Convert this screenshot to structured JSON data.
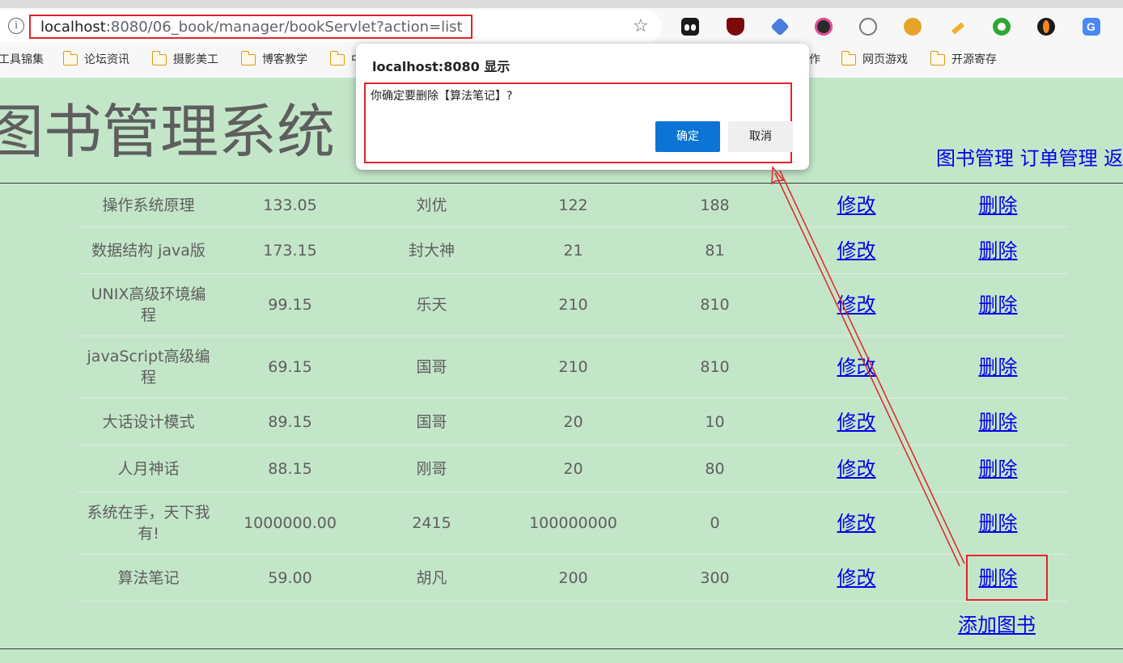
{
  "browser": {
    "url_host": "localhost",
    "url_rest": ":8080/06_book/manager/bookServlet?action=list",
    "bookmarks": [
      "工具锦集",
      "论坛资讯",
      "摄影美工",
      "博客教学",
      "中",
      "作",
      "网页游戏",
      "开源寄存"
    ]
  },
  "page": {
    "title": "图书管理系统",
    "nav": [
      "图书管理",
      "订单管理",
      "返"
    ],
    "rows": [
      {
        "name": "操作系统原理",
        "price": "133.05",
        "author": "刘优",
        "sales": "122",
        "stock": "188",
        "edit": "修改",
        "delete": "删除"
      },
      {
        "name": "数据结构 java版",
        "price": "173.15",
        "author": "封大神",
        "sales": "21",
        "stock": "81",
        "edit": "修改",
        "delete": "删除"
      },
      {
        "name": "UNIX高级环境编程",
        "price": "99.15",
        "author": "乐天",
        "sales": "210",
        "stock": "810",
        "edit": "修改",
        "delete": "删除"
      },
      {
        "name": "javaScript高级编程",
        "price": "69.15",
        "author": "国哥",
        "sales": "210",
        "stock": "810",
        "edit": "修改",
        "delete": "删除"
      },
      {
        "name": "大话设计模式",
        "price": "89.15",
        "author": "国哥",
        "sales": "20",
        "stock": "10",
        "edit": "修改",
        "delete": "删除"
      },
      {
        "name": "人月神话",
        "price": "88.15",
        "author": "刚哥",
        "sales": "20",
        "stock": "80",
        "edit": "修改",
        "delete": "删除"
      },
      {
        "name": "系统在手，天下我有!",
        "price": "1000000.00",
        "author": "2415",
        "sales": "100000000",
        "stock": "0",
        "edit": "修改",
        "delete": "删除"
      },
      {
        "name": "算法笔记",
        "price": "59.00",
        "author": "胡凡",
        "sales": "200",
        "stock": "300",
        "edit": "修改",
        "delete": "删除"
      }
    ],
    "add_book": "添加图书"
  },
  "dialog": {
    "title": "localhost:8080 显示",
    "message": "你确定要删除【算法笔记】?",
    "ok": "确定",
    "cancel": "取消"
  },
  "colors": {
    "page_bg": "#c3e6c8",
    "link": "#0000ee",
    "annotation": "#e0242b",
    "primary_button": "#0b74d4"
  }
}
